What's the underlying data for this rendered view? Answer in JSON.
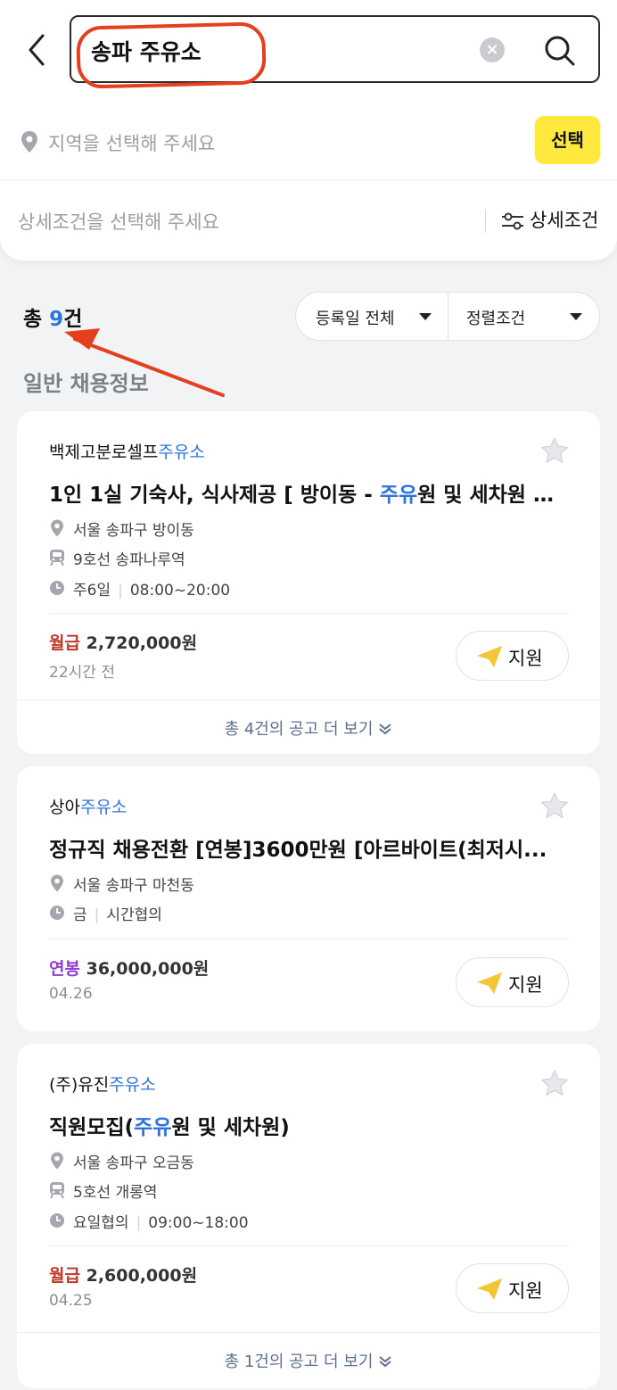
{
  "search": {
    "query": "송파 주유소"
  },
  "region": {
    "placeholder": "지역을 선택해 주세요",
    "select_label": "선택"
  },
  "conditions": {
    "placeholder": "상세조건을 선택해 주세요",
    "button_label": "상세조건"
  },
  "results": {
    "total_prefix": "총 ",
    "total_count": "9",
    "total_suffix": "건",
    "date_filter": "등록일 전체",
    "sort_filter": "정렬조건",
    "section_title": "일반 채용정보"
  },
  "jobs": [
    {
      "company_prefix": "백제고분로셀프",
      "company_highlight": "주유소",
      "title_parts": [
        "1인 1실 기숙사, 식사제공 [ 방이동 - ",
        "주유",
        "원 및 세차원 모..."
      ],
      "location": "서울 송파구 방이동",
      "station": "9호선 송파나루역",
      "days": "주6일",
      "hours": "08:00~20:00",
      "pay_type": "월급",
      "pay_amount": "2,720,000원",
      "posted": "22시간 전",
      "apply_label": "지원",
      "more_label": "총 4건의 공고 더 보기"
    },
    {
      "company_prefix": "상아",
      "company_highlight": "주유소",
      "title_parts": [
        "정규직 채용전환 [연봉]3600만원 [아르바이트(최저시...",
        "",
        ""
      ],
      "location": "서울 송파구 마천동",
      "days": "금",
      "hours": "시간협의",
      "pay_type": "연봉",
      "pay_amount": "36,000,000원",
      "posted": "04.26",
      "apply_label": "지원"
    },
    {
      "company_prefix": "(주)유진",
      "company_highlight": "주유소",
      "title_parts": [
        "직원모집(",
        "주유",
        "원 및 세차원)"
      ],
      "location": "서울 송파구 오금동",
      "station": "5호선 개롱역",
      "days": "요일협의",
      "hours": "09:00~18:00",
      "pay_type": "월급",
      "pay_amount": "2,600,000원",
      "posted": "04.25",
      "apply_label": "지원",
      "more_label": "총 1건의 공고 더 보기"
    }
  ],
  "colors": {
    "accent_blue": "#2e74e0",
    "select_yellow": "#ffe83d",
    "monthly_pay_red": "#c0392b",
    "annual_pay_purple": "#8e3fd6",
    "annotation_red": "#e53f1f"
  },
  "icons": [
    "back-arrow-icon",
    "clear-icon",
    "search-icon",
    "location-pin-icon",
    "filter-icon",
    "caret-down-icon",
    "star-icon",
    "subway-icon",
    "clock-icon",
    "paper-plane-icon",
    "double-chevron-down-icon"
  ]
}
